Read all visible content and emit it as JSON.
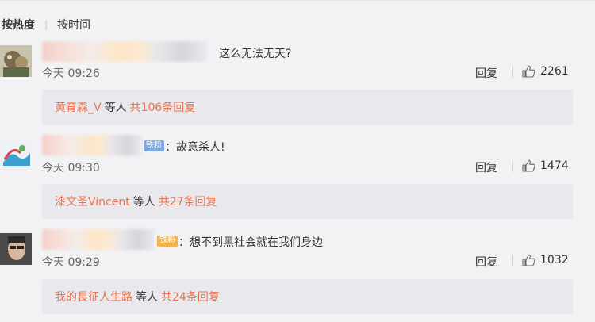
{
  "sort": {
    "hot": "按热度",
    "separator": "|",
    "time": "按时间"
  },
  "comments": [
    {
      "text": "这么无法无天?",
      "time": "今天 09:26",
      "reply_label": "回复",
      "likes": "2261",
      "replies": {
        "names": "黄育森_V",
        "etc": "等人",
        "total": "共106条回复"
      }
    },
    {
      "badge": "铁粉",
      "text": "：故意杀人!",
      "time": "今天 09:30",
      "reply_label": "回复",
      "likes": "1474",
      "replies": {
        "names": "漆文圣Vincent",
        "etc": "等人",
        "total": "共27条回复"
      }
    },
    {
      "badge": "铁粉",
      "text": "：想不到黑社会就在我们身边",
      "time": "今天 09:29",
      "reply_label": "回复",
      "likes": "1032",
      "replies": {
        "names": "我的長征人生路",
        "etc": "等人",
        "total": "共24条回复"
      }
    }
  ],
  "colors": {
    "accent": "#eb7350",
    "background": "#f2f2f5",
    "reply_box": "#e9e9ed",
    "badge_blue": "#7aa9e6",
    "badge_orange": "#f3b24b"
  },
  "icons": {
    "like": "thumbs-up-icon"
  }
}
